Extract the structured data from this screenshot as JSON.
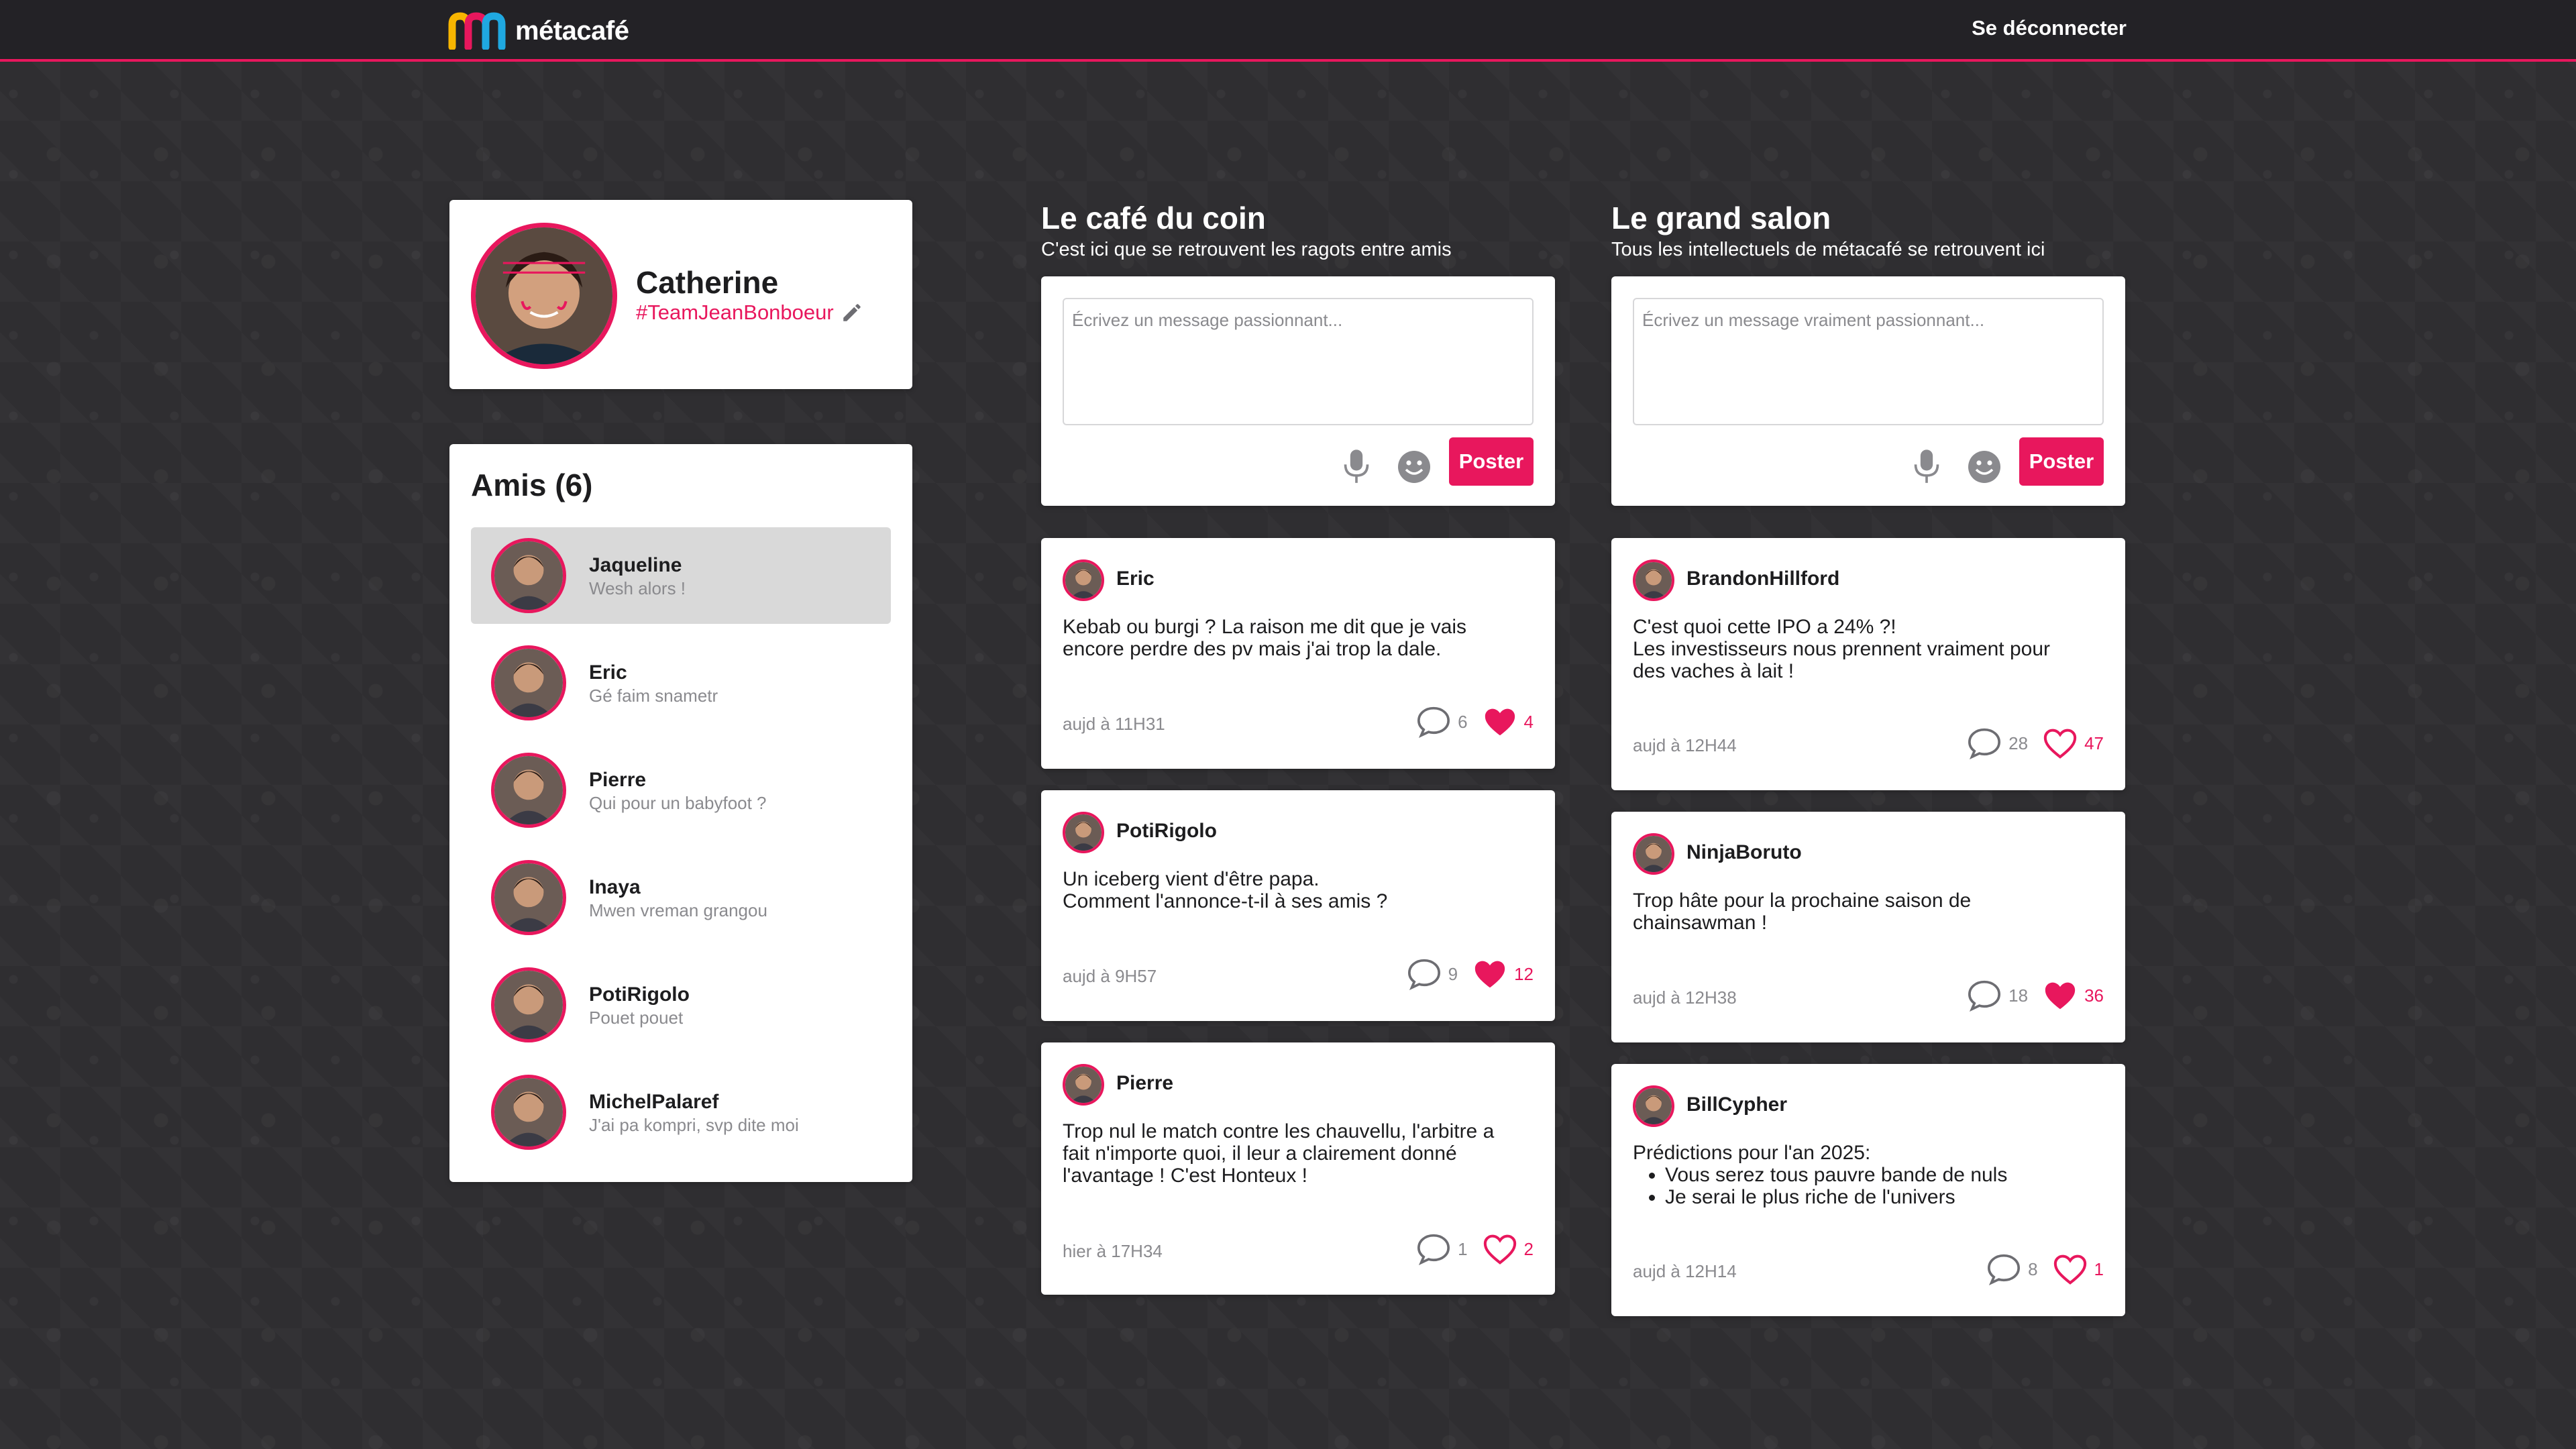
{
  "colors": {
    "accent": "#e8175d",
    "topbar": "#232226",
    "background": "#2f2e31",
    "muted": "#8a8a8e"
  },
  "app": {
    "name": "métacafé",
    "logout_label": "Se déconnecter"
  },
  "profile": {
    "name": "Catherine",
    "team": "#TeamJeanBonboeur"
  },
  "friends": {
    "title": "Amis (6)",
    "items": [
      {
        "name": "Jaqueline",
        "message": "Wesh alors !",
        "active": true
      },
      {
        "name": "Eric",
        "message": "Gé faim snametr"
      },
      {
        "name": "Pierre",
        "message": "Qui pour un babyfoot ?"
      },
      {
        "name": "Inaya",
        "message": "Mwen vreman grangou"
      },
      {
        "name": "PotiRigolo",
        "message": "Pouet pouet"
      },
      {
        "name": "MichelPalaref",
        "message": "J'ai pa kompri, svp dite moi"
      }
    ]
  },
  "cafe": {
    "title": "Le café du coin",
    "subtitle": "C'est ici que se retrouvent les ragots entre amis",
    "placeholder": "Écrivez un message passionnant...",
    "post_label": "Poster",
    "posts": [
      {
        "author": "Eric",
        "lines": [
          "Kebab ou burgi ? La raison me dit que je vais",
          "encore perdre des pv mais j'ai trop la dale."
        ],
        "time": "aujd à 11H31",
        "comments": "6",
        "likes": "4",
        "liked": true
      },
      {
        "author": "PotiRigolo",
        "lines": [
          "Un iceberg vient d'être papa.",
          "Comment l'annonce-t-il à ses amis ?"
        ],
        "time": "aujd à 9H57",
        "comments": "9",
        "likes": "12",
        "liked": true
      },
      {
        "author": "Pierre",
        "lines": [
          "Trop nul le match contre les chauvellu, l'arbitre a",
          "fait n'importe quoi, il leur a clairement donné",
          "l'avantage ! C'est Honteux !"
        ],
        "time": "hier à 17H34",
        "comments": "1",
        "likes": "2",
        "liked": false
      }
    ]
  },
  "salon": {
    "title": "Le grand salon",
    "subtitle": "Tous les intellectuels de métacafé se retrouvent ici",
    "placeholder": "Écrivez un message vraiment passionnant...",
    "post_label": "Poster",
    "posts": [
      {
        "author": "BrandonHillford",
        "lines": [
          "C'est quoi cette IPO a 24% ?!",
          "Les investisseurs nous prennent vraiment pour",
          "des vaches à lait !"
        ],
        "time": "aujd à 12H44",
        "comments": "28",
        "likes": "47",
        "liked": false
      },
      {
        "author": "NinjaBoruto",
        "lines": [
          "Trop hâte pour la prochaine saison de",
          "chainsawman !"
        ],
        "time": "aujd à 12H38",
        "comments": "18",
        "likes": "36",
        "liked": true
      },
      {
        "author": "BillCypher",
        "lines": [
          "Prédictions pour l'an 2025:"
        ],
        "bullets": [
          "Vous serez tous pauvre bande de nuls",
          "Je serai le plus riche de l'univers"
        ],
        "time": "aujd à 12H14",
        "comments": "8",
        "likes": "1",
        "liked": false
      }
    ]
  }
}
